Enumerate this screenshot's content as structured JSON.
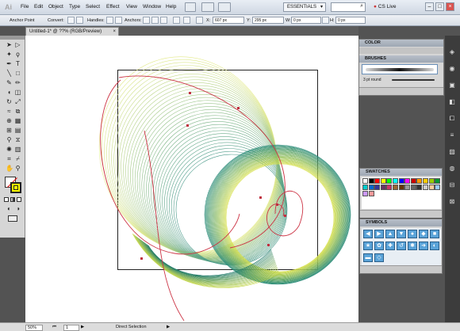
{
  "app": {
    "logo": "Ai"
  },
  "menu": [
    "File",
    "Edit",
    "Object",
    "Type",
    "Select",
    "Effect",
    "View",
    "Window",
    "Help"
  ],
  "workspace": {
    "label": "ESSENTIALS",
    "cs_live": "CS Live"
  },
  "control": {
    "tool_name": "Anchor Point",
    "convert_label": "Convert:",
    "handles_label": "Handles:",
    "anchors_label": "Anchors:",
    "x_label": "X:",
    "x_value": "607 px",
    "y_label": "Y:",
    "y_value": "295 px",
    "w_label": "W:",
    "w_value": "0 px",
    "h_label": "H:",
    "h_value": "0 px"
  },
  "document": {
    "tab_title": "Untitled-1* @ ??% (RGB/Preview)"
  },
  "status": {
    "zoom": "50%",
    "page": "1",
    "tool": "Direct Selection"
  },
  "panels": {
    "color": {
      "title": "COLOR"
    },
    "brushes": {
      "title": "BRUSHES",
      "brush_label": "3 pt round"
    },
    "swatches": {
      "title": "SWATCHES"
    },
    "symbols": {
      "title": "SYMBOLS"
    }
  },
  "colors": {
    "path": "#cc3344",
    "selection": "#c03040",
    "panel_header": "#a7afba"
  }
}
